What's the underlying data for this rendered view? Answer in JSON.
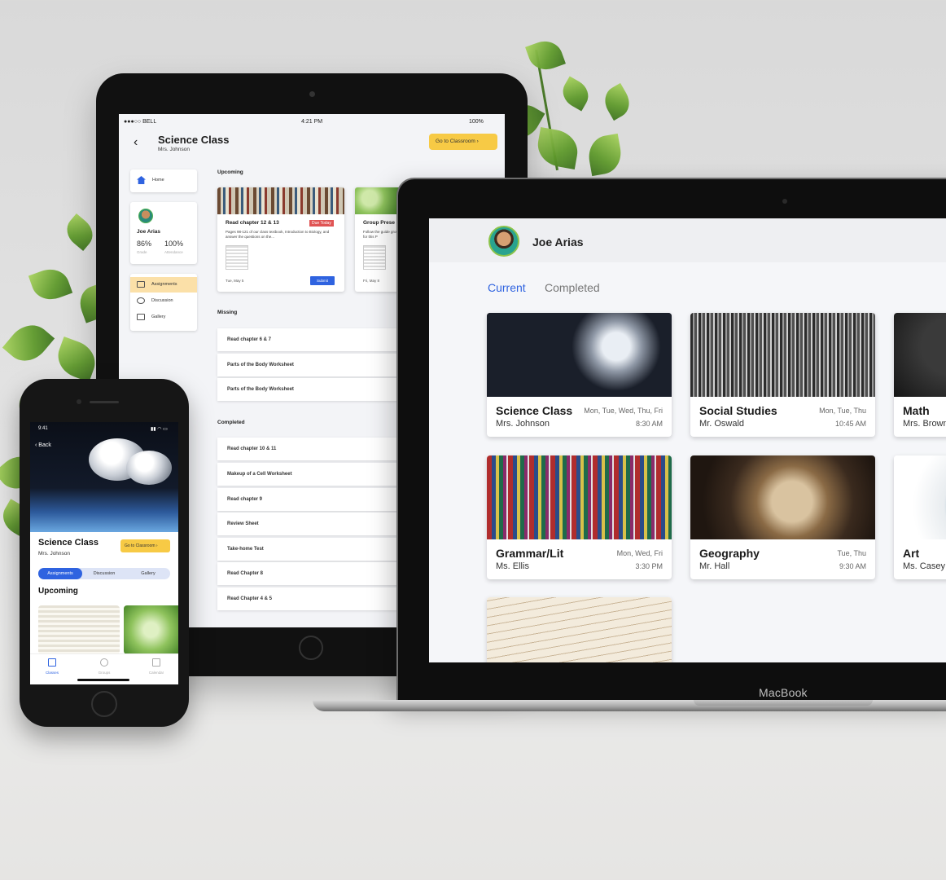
{
  "tablet": {
    "status": {
      "carrier": "●●●○○ BELL",
      "time": "4:21 PM",
      "battery": "100%"
    },
    "title": "Science Class",
    "teacher": "Mrs. Johnson",
    "go_classroom": "Go to Classroom",
    "sidebar": {
      "home": "Home",
      "student_name": "Joe Arias",
      "grade_value": "86%",
      "grade_label": "Grade",
      "attendance_value": "100%",
      "attendance_label": "Attendance",
      "items": [
        {
          "label": "Assignments",
          "active": true
        },
        {
          "label": "Discussion",
          "active": false
        },
        {
          "label": "Gallery",
          "active": false
        }
      ]
    },
    "upcoming_label": "Upcoming",
    "upcoming": [
      {
        "title": "Read chapter 12 & 13",
        "badge": "Due Today",
        "desc": "Pages 98-121 of our class textbook, Introduction to Biology, and answer the questions on the...",
        "date": "Tue, May 5",
        "action": "Submit"
      },
      {
        "title": "Group Prese",
        "desc": "Follow the guide groups for this P",
        "date": "Fri, May 8"
      }
    ],
    "missing_label": "Missing",
    "missing": [
      "Read chapter 6 & 7",
      "Parts of the Body Worksheet",
      "Parts of the Body Worksheet"
    ],
    "completed_label": "Completed",
    "completed": [
      "Read chapter 10 & 11",
      "Makeup of a Cell Worksheet",
      "Read chapter 9",
      "Review Sheet",
      "Take-home Test",
      "Read Chapter  8",
      "Read Chapter 4 & 5"
    ]
  },
  "phone": {
    "time": "9:41",
    "back": "Back",
    "title": "Science Class",
    "teacher": "Mrs. Johnson",
    "go_classroom": "Go to Classroom",
    "segments": [
      "Assignments",
      "Discussion",
      "Gallery"
    ],
    "upcoming": "Upcoming",
    "tabs": [
      "Classes",
      "Groups",
      "Calendar"
    ]
  },
  "laptop": {
    "brand": "MacBook",
    "user": "Joe Arias",
    "tabs": {
      "current": "Current",
      "completed": "Completed"
    },
    "classes": [
      {
        "name": "Science Class",
        "teacher": "Mrs. Johnson",
        "days": "Mon, Tue, Wed, Thu, Fri",
        "time": "8:30 AM"
      },
      {
        "name": "Social Studies",
        "teacher": "Mr. Oswald",
        "days": "Mon, Tue, Thu",
        "time": "10:45 AM"
      },
      {
        "name": "Math",
        "teacher": "Mrs. Brown",
        "days": "",
        "time": ""
      },
      {
        "name": "Grammar/Lit",
        "teacher": "Ms. Ellis",
        "days": "Mon, Wed, Fri",
        "time": "3:30 PM"
      },
      {
        "name": "Geography",
        "teacher": "Mr. Hall",
        "days": "Tue, Thu",
        "time": "9:30 AM"
      },
      {
        "name": "Art",
        "teacher": "Ms. Casey",
        "days": "",
        "time": ""
      }
    ]
  },
  "colors": {
    "accent": "#2f63e0",
    "button_yellow": "#f7ca45",
    "due_red": "#e05454",
    "active_menu": "#fbe0a8"
  }
}
